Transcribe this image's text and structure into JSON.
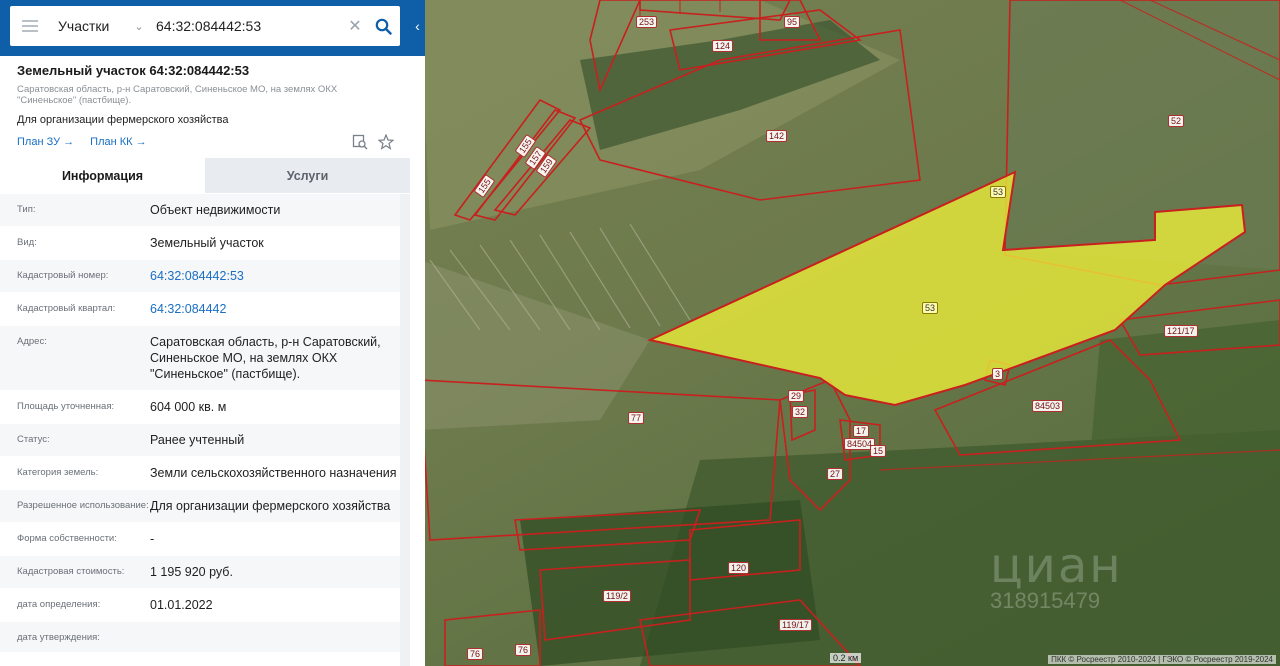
{
  "search": {
    "category": "Участки",
    "query": "64:32:084442:53"
  },
  "object": {
    "title": "Земельный участок 64:32:084442:53",
    "address": "Саратовская область, р-н Саратовский, Синеньское МО, на землях ОКХ \"Синеньское\" (пастбище).",
    "purpose": "Для организации фермерского хозяйства",
    "plan_zu": "План ЗУ",
    "plan_kk": "План КК"
  },
  "tabs": {
    "info": "Информация",
    "services": "Услуги"
  },
  "info_rows": [
    {
      "label": "Тип:",
      "value": "Объект недвижимости"
    },
    {
      "label": "Вид:",
      "value": "Земельный участок"
    },
    {
      "label": "Кадастровый номер:",
      "value": "64:32:084442:53"
    },
    {
      "label": "Кадастровый квартал:",
      "value": "64:32:084442"
    },
    {
      "label": "Адрес:",
      "value": "Саратовская область, р-н Саратовский, Синеньское МО, на землях ОКХ \"Синеньское\" (пастбище)."
    },
    {
      "label": "Площадь уточненная:",
      "value": "604 000 кв. м"
    },
    {
      "label": "Статус:",
      "value": "Ранее учтенный"
    },
    {
      "label": "Категория земель:",
      "value": "Земли сельскохозяйственного назначения"
    },
    {
      "label": "Разрешенное использование:",
      "value": "Для организации фермерского хозяйства"
    },
    {
      "label": "Форма собственности:",
      "value": "-"
    },
    {
      "label": "Кадастровая стоимость:",
      "value": "1 195 920 руб."
    },
    {
      "label": "дата определения:",
      "value": "01.01.2022"
    },
    {
      "label": "дата утверждения:",
      "value": ""
    }
  ],
  "map": {
    "labels": [
      "253",
      "95",
      "124",
      "142",
      "52",
      "155",
      "157",
      "159",
      "155",
      "53",
      "53",
      "121/17",
      "3",
      "84503",
      "29",
      "32",
      "17",
      "84504",
      "15",
      "27",
      "77",
      "120",
      "119/2",
      "119/17",
      "76",
      "76"
    ],
    "scale": "0.2 км",
    "credit": "ПКК © Росреестр 2010-2024 | ГЭКО © Росреестр 2019-2024",
    "watermark": "циан",
    "watermark_id": "318915479"
  },
  "colors": {
    "header_blue": "#0e5ea8",
    "link_blue": "#1a6fc4",
    "parcel_border": "#c8201e",
    "selected_fill": "#f2f23a"
  }
}
